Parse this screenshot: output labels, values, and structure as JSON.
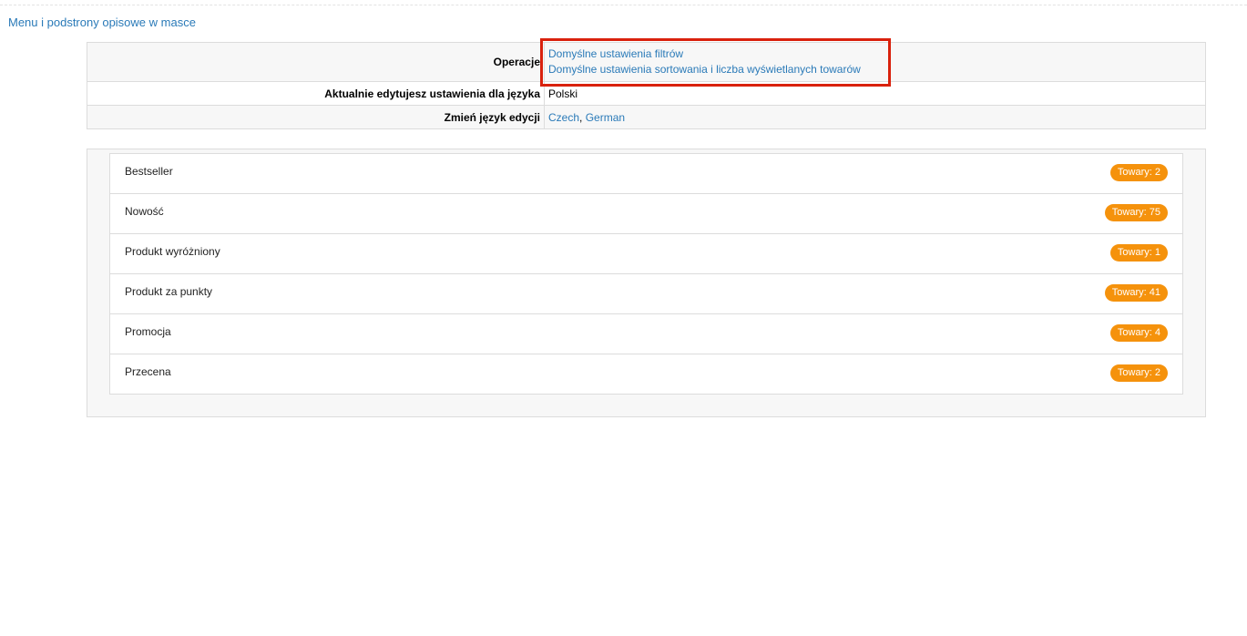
{
  "breadcrumb": {
    "label": "Menu i podstrony opisowe w masce"
  },
  "settings": {
    "operations": {
      "label": "Operacje",
      "links": [
        "Domyślne ustawienia filtrów",
        "Domyślne ustawienia sortowania i liczba wyświetlanych towarów"
      ]
    },
    "current_language": {
      "label": "Aktualnie edytujesz ustawienia dla języka",
      "value": "Polski"
    },
    "change_language": {
      "label": "Zmień język edycji",
      "options": [
        "Czech",
        "German"
      ],
      "separator": ", "
    }
  },
  "highlight_color": "#d9210d",
  "badge_color": "#f5920c",
  "link_color": "#2a7ab8",
  "items": [
    {
      "label": "Bestseller",
      "count": "Towary: 2"
    },
    {
      "label": "Nowość",
      "count": "Towary: 75"
    },
    {
      "label": "Produkt wyróżniony",
      "count": "Towary: 1"
    },
    {
      "label": "Produkt za punkty",
      "count": "Towary: 41"
    },
    {
      "label": "Promocja",
      "count": "Towary: 4"
    },
    {
      "label": "Przecena",
      "count": "Towary: 2"
    }
  ]
}
